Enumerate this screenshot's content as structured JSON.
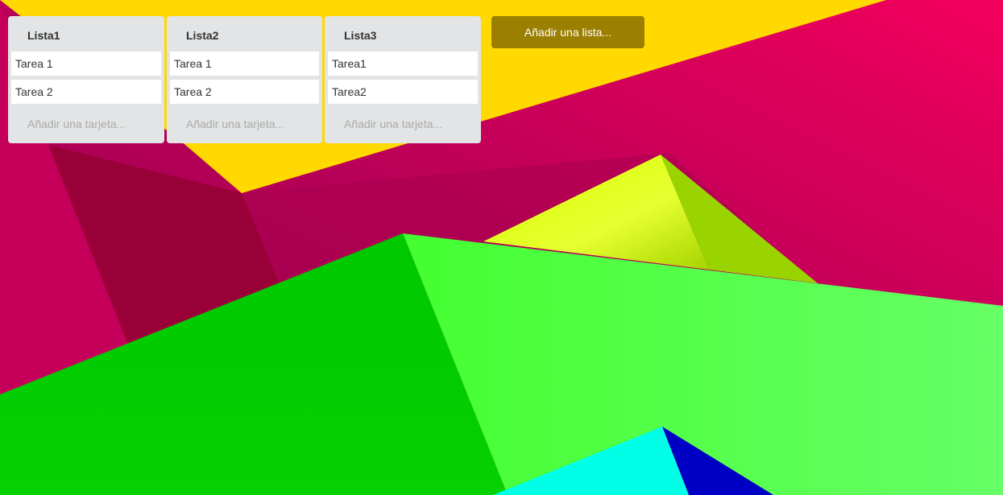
{
  "lists": [
    {
      "title": "Lista1",
      "cards": [
        "Tarea 1",
        "Tarea 2"
      ],
      "add_card_label": "Añadir una tarjeta..."
    },
    {
      "title": "Lista2",
      "cards": [
        "Tarea 1",
        "Tarea 2"
      ],
      "add_card_label": "Añadir una tarjeta..."
    },
    {
      "title": "Lista3",
      "cards": [
        "Tarea1",
        "Tarea2"
      ],
      "add_card_label": "Añadir una tarjeta..."
    }
  ],
  "add_list_label": "Añadir una lista...",
  "colors": {
    "list_background": "#e2e4e6",
    "add_list_button": "#9b7f00",
    "placeholder_text": "#aaaaaa"
  }
}
